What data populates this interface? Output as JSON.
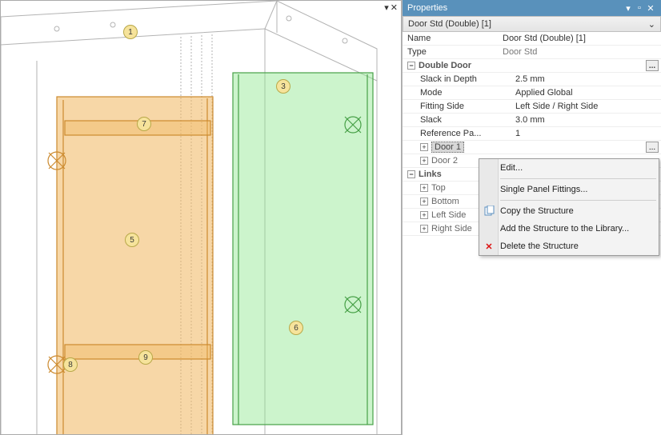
{
  "panel": {
    "title": "Properties",
    "subtitle": "Door Std (Double) [1]",
    "name_label": "Name",
    "name_value": "Door Std (Double) [1]",
    "type_label": "Type",
    "type_value": "Door Std",
    "double_door": "Double Door",
    "slack_depth_label": "Slack in Depth",
    "slack_depth_value": "2.5 mm",
    "mode_label": "Mode",
    "mode_value": "Applied Global",
    "fitting_label": "Fitting Side",
    "fitting_value": "Left Side / Right Side",
    "slack_label": "Slack",
    "slack_value": "3.0 mm",
    "ref_label": "Reference Pa...",
    "ref_value": "1",
    "door1": "Door 1",
    "door2": "Door 2",
    "links": "Links",
    "top": "Top",
    "bottom": "Bottom",
    "left": "Left Side",
    "right": "Right Side",
    "ellipsis": "..."
  },
  "context_menu": {
    "edit": "Edit...",
    "single_panel": "Single Panel Fittings...",
    "copy": "Copy the Structure",
    "add_lib": "Add the Structure to the Library...",
    "delete": "Delete the Structure"
  },
  "viewport": {
    "badges": {
      "b1": "1",
      "b3": "3",
      "b5": "5",
      "b6": "6",
      "b7": "7",
      "b8": "8",
      "b9": "9"
    }
  }
}
